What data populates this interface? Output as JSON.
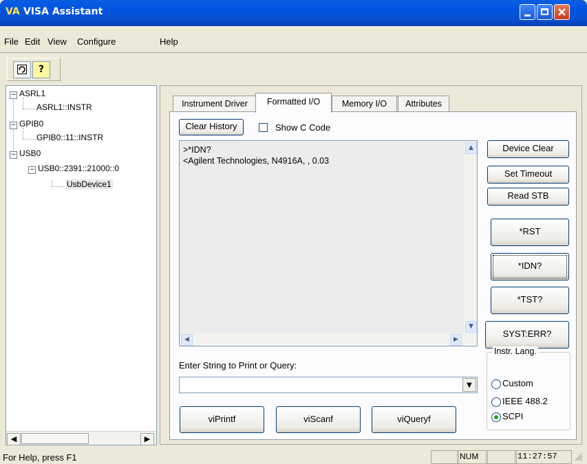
{
  "window": {
    "logo": "VA",
    "title": "VISA Assistant"
  },
  "menu": [
    "File",
    "Edit",
    "View",
    "Configure",
    "Help"
  ],
  "toolbar": {
    "refresh_icon": "refresh-icon",
    "help_icon": "help-icon"
  },
  "tree": [
    {
      "label": "ASRL1",
      "expander": "−"
    },
    {
      "label": "ASRL1::INSTR"
    },
    {
      "label": "GPIB0",
      "expander": "−"
    },
    {
      "label": "GPIB0::11::INSTR"
    },
    {
      "label": "USB0",
      "expander": "−"
    },
    {
      "label": "USB0::2391::21000::0",
      "expander": "−"
    },
    {
      "label": "UsbDevice1",
      "selected": true
    }
  ],
  "tabs": [
    "Instrument Driver",
    "Formatted I/O",
    "Memory I/O",
    "Attributes"
  ],
  "active_tab": "Formatted I/O",
  "buttons": {
    "clear_history": "Clear History",
    "show_c_code": "Show C Code",
    "device_clear": "Device Clear",
    "set_timeout": "Set Timeout",
    "read_stb": "Read STB",
    "rst": "*RST",
    "idn": "*IDN?",
    "tst": "*TST?",
    "syst_err": "SYST:ERR?",
    "viprintf": "viPrintf",
    "viscanf": "viScanf",
    "viqueryf": "viQueryf"
  },
  "history": ">*IDN?\n<Agilent Technologies, N4916A, , 0.03",
  "input_label": "Enter String to Print or Query:",
  "input_value": "",
  "instr_lang": {
    "legend": "Instr. Lang.",
    "options": [
      "Custom",
      "IEEE 488.2",
      "SCPI"
    ],
    "selected": "SCPI"
  },
  "status": {
    "help_text": "For Help, press F1",
    "num": "NUM",
    "time": "11:27:57"
  },
  "colors": {
    "titlebar": "#0054e3",
    "window_bg": "#ece9d8",
    "radio_selected": "#21a121"
  }
}
